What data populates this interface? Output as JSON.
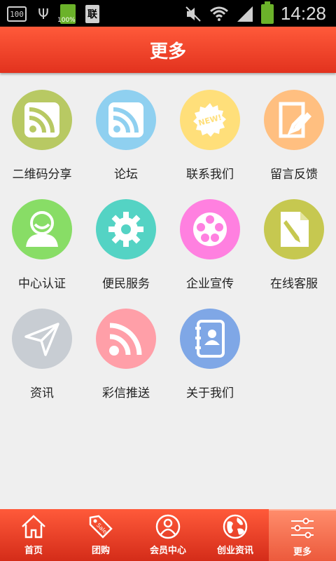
{
  "status_bar": {
    "left_box": "100",
    "battery_small_label": "100%",
    "sim_label": "联",
    "time": "14:28"
  },
  "header": {
    "title": "更多"
  },
  "grid": {
    "items": [
      {
        "label": "二维码分享",
        "icon": "rss-icon",
        "color": "#b8c963"
      },
      {
        "label": "论坛",
        "icon": "rss-icon",
        "color": "#8fd0f0"
      },
      {
        "label": "联系我们",
        "icon": "new-badge-icon",
        "color": "#ffdf7a"
      },
      {
        "label": "留言反馈",
        "icon": "edit-note-icon",
        "color": "#ffbf80"
      },
      {
        "label": "中心认证",
        "icon": "user-icon",
        "color": "#88dd66"
      },
      {
        "label": "便民服务",
        "icon": "gear-icon",
        "color": "#54d3c4"
      },
      {
        "label": "企业宣传",
        "icon": "film-reel-icon",
        "color": "#ff80e0"
      },
      {
        "label": "在线客服",
        "icon": "document-edit-icon",
        "color": "#c6c850"
      },
      {
        "label": "资讯",
        "icon": "paper-plane-icon",
        "color": "#c8cdd3"
      },
      {
        "label": "彩信推送",
        "icon": "rss-icon",
        "color": "#ff9fa8"
      },
      {
        "label": "关于我们",
        "icon": "contact-book-icon",
        "color": "#7fa7e6"
      }
    ]
  },
  "bottom_nav": {
    "items": [
      {
        "label": "首页",
        "icon": "home-icon"
      },
      {
        "label": "团购",
        "icon": "sale-tag-icon"
      },
      {
        "label": "会员中心",
        "icon": "member-icon"
      },
      {
        "label": "创业资讯",
        "icon": "globe-icon"
      },
      {
        "label": "更多",
        "icon": "sliders-icon",
        "active": true
      }
    ]
  }
}
